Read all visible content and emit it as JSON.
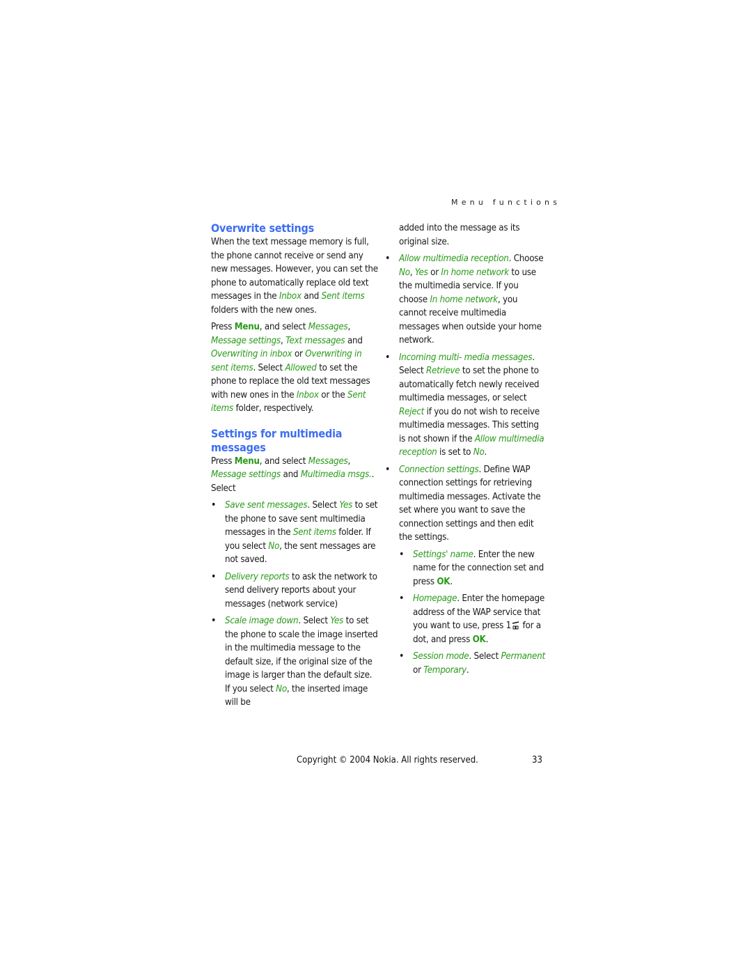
{
  "header": {
    "section": "Menu functions"
  },
  "left": {
    "overwrite": {
      "heading": "Overwrite settings",
      "p1": [
        {
          "t": "When the text message memory is full, the phone cannot receive or send any new messages. However, you can set the phone to automatically replace old text messages in the "
        },
        {
          "t": "Inbox",
          "s": "g"
        },
        {
          "t": " and "
        },
        {
          "t": "Sent items",
          "s": "g"
        },
        {
          "t": " folders with the new ones."
        }
      ],
      "p2": [
        {
          "t": "Press "
        },
        {
          "t": "Menu",
          "s": "b"
        },
        {
          "t": ", and select "
        },
        {
          "t": "Messages",
          "s": "g"
        },
        {
          "t": ", "
        },
        {
          "t": "Message settings",
          "s": "g"
        },
        {
          "t": ", "
        },
        {
          "t": "Text messages",
          "s": "g"
        },
        {
          "t": " and "
        },
        {
          "t": "Overwriting in inbox",
          "s": "g"
        },
        {
          "t": " or "
        },
        {
          "t": "Overwriting in sent items",
          "s": "g"
        },
        {
          "t": ". Select "
        },
        {
          "t": "Allowed",
          "s": "g"
        },
        {
          "t": " to set the phone to replace the old text messages with new ones in the "
        },
        {
          "t": "Inbox",
          "s": "g"
        },
        {
          "t": " or the "
        },
        {
          "t": "Sent items",
          "s": "g"
        },
        {
          "t": " folder, respectively."
        }
      ]
    },
    "multimedia": {
      "heading": "Settings for multimedia messages",
      "intro": [
        {
          "t": "Press "
        },
        {
          "t": "Menu",
          "s": "b"
        },
        {
          "t": ", and select "
        },
        {
          "t": "Messages",
          "s": "g"
        },
        {
          "t": ", "
        },
        {
          "t": "Message settings",
          "s": "g"
        },
        {
          "t": " and "
        },
        {
          "t": "Multimedia msgs.",
          "s": "g"
        },
        {
          "t": ". Select"
        }
      ],
      "bullets": [
        [
          {
            "t": "Save sent messages",
            "s": "g"
          },
          {
            "t": ". Select "
          },
          {
            "t": "Yes",
            "s": "g"
          },
          {
            "t": " to set the phone to save sent multimedia messages in the "
          },
          {
            "t": "Sent items",
            "s": "g"
          },
          {
            "t": " folder. If you select "
          },
          {
            "t": "No",
            "s": "g"
          },
          {
            "t": ", the sent messages are not saved."
          }
        ],
        [
          {
            "t": "Delivery reports",
            "s": "g"
          },
          {
            "t": " to ask the network to send delivery reports about your messages (network service)"
          }
        ],
        [
          {
            "t": "Scale image down",
            "s": "g"
          },
          {
            "t": ". Select "
          },
          {
            "t": "Yes",
            "s": "g"
          },
          {
            "t": " to set the phone to scale the image inserted in the multimedia message to the default size, if the original size of the image is larger than the default size. If you select "
          },
          {
            "t": "No",
            "s": "g"
          },
          {
            "t": ", the inserted image will be"
          }
        ]
      ]
    }
  },
  "right": {
    "continuation": "added into the message as its original size.",
    "bullets": [
      [
        {
          "t": "Allow multimedia reception",
          "s": "g"
        },
        {
          "t": ". Choose "
        },
        {
          "t": "No",
          "s": "g"
        },
        {
          "t": ", "
        },
        {
          "t": "Yes",
          "s": "g"
        },
        {
          "t": " or "
        },
        {
          "t": "In home network",
          "s": "g"
        },
        {
          "t": " to use the multimedia service. If you choose "
        },
        {
          "t": "In home network",
          "s": "g"
        },
        {
          "t": ", you cannot receive multimedia messages when outside your home network."
        }
      ],
      [
        {
          "t": "Incoming multi- media messages",
          "s": "g"
        },
        {
          "t": ". Select "
        },
        {
          "t": "Retrieve",
          "s": "g"
        },
        {
          "t": " to set the phone to automatically fetch newly received multimedia messages, or select "
        },
        {
          "t": "Reject",
          "s": "g"
        },
        {
          "t": " if you do not wish to receive multimedia messages. This setting is not shown if the "
        },
        {
          "t": "Allow multimedia reception",
          "s": "g"
        },
        {
          "t": " is set to "
        },
        {
          "t": "No",
          "s": "g"
        },
        {
          "t": "."
        }
      ],
      [
        {
          "t": "Connection settings",
          "s": "g"
        },
        {
          "t": ". Define WAP connection settings for retrieving multimedia messages. Activate the set where you want to save the connection settings and then edit the settings."
        }
      ]
    ],
    "sub_bullets": [
      [
        {
          "t": "Settings' name",
          "s": "g"
        },
        {
          "t": ". Enter the new name for the connection set and press "
        },
        {
          "t": "OK",
          "s": "b"
        },
        {
          "t": "."
        }
      ],
      [
        {
          "t": "Homepage",
          "s": "g"
        },
        {
          "t": ". Enter the homepage address of the WAP service that you want to use, press 1"
        },
        {
          "icon": "key-1-icon"
        },
        {
          "t": " for a dot, and press "
        },
        {
          "t": "OK",
          "s": "b"
        },
        {
          "t": "."
        }
      ],
      [
        {
          "t": "Session mode",
          "s": "g"
        },
        {
          "t": ". Select "
        },
        {
          "t": "Permanent",
          "s": "g"
        },
        {
          "t": " or "
        },
        {
          "t": "Temporary",
          "s": "g"
        },
        {
          "t": "."
        }
      ]
    ]
  },
  "footer": {
    "copyright": "Copyright © 2004 Nokia. All rights reserved.",
    "page_number": "33"
  },
  "colors": {
    "heading": "#3d6ef0",
    "term": "#2a9a1a"
  }
}
